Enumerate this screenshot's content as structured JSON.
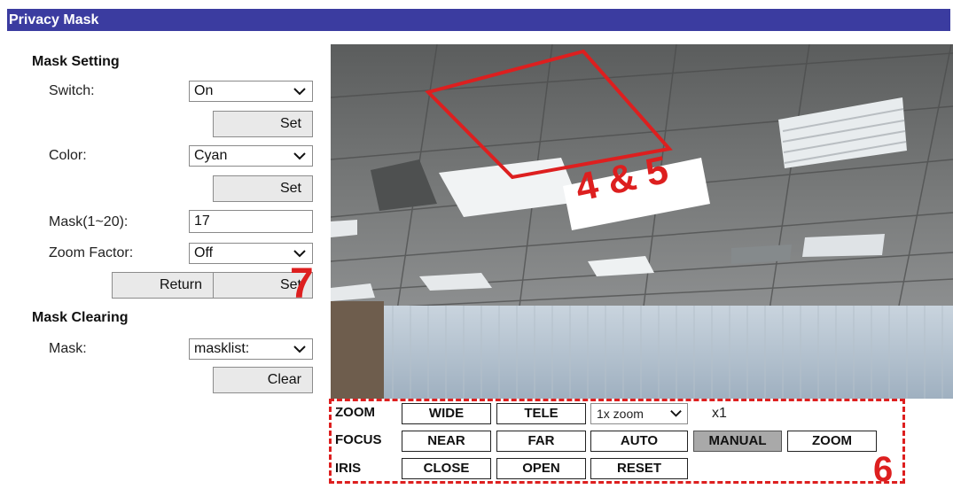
{
  "title": "Privacy Mask",
  "mask_setting": {
    "header": "Mask Setting",
    "switch_label": "Switch:",
    "switch_value": "On",
    "set_label": "Set",
    "color_label": "Color:",
    "color_value": "Cyan",
    "mask_label": "Mask(1~20):",
    "mask_value": "17",
    "zoom_factor_label": "Zoom Factor:",
    "zoom_factor_value": "Off",
    "return_label": "Return"
  },
  "mask_clearing": {
    "header": "Mask Clearing",
    "mask_label": "Mask:",
    "mask_value": "masklist:",
    "clear_label": "Clear"
  },
  "controls": {
    "zoom_label": "ZOOM",
    "wide": "WIDE",
    "tele": "TELE",
    "zoom_select": "1x zoom",
    "zoom_level": "x1",
    "focus_label": "FOCUS",
    "near": "NEAR",
    "far": "FAR",
    "auto": "AUTO",
    "manual": "MANUAL",
    "zoom_btn": "ZOOM",
    "iris_label": "IRIS",
    "close": "CLOSE",
    "open": "OPEN",
    "reset": "RESET"
  },
  "annotations": {
    "a45": "4 & 5",
    "a6": "6",
    "a7": "7"
  },
  "colors": {
    "title_bar": "#3b3ca0",
    "annotation": "#dd1f1f",
    "manual_active": "#a9a9a9"
  }
}
